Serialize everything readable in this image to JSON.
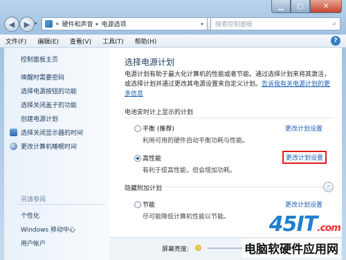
{
  "window": {
    "minimize_glyph": "▁",
    "maximize_glyph": "□",
    "close_glyph": "✕"
  },
  "nav": {
    "back_glyph": "◀",
    "forward_glyph": "▶",
    "dropdown_glyph": "▾",
    "breadcrumb_lead": "«",
    "breadcrumb": [
      "硬件和声音",
      "电源选项"
    ],
    "breadcrumb_sep": "▸",
    "refresh_glyph": "↻",
    "search_placeholder": "搜索控制面板",
    "search_glyph": "⌕"
  },
  "menu": {
    "items": [
      "文件(F)",
      "编辑(E)",
      "查看(V)",
      "工具(T)",
      "帮助(H)"
    ],
    "help_glyph": "?"
  },
  "sidebar": {
    "home": "控制面板主页",
    "items": [
      "唤醒时需要密码",
      "选择电源按钮的功能",
      "选择关闭盖子的功能",
      "创建电源计划",
      "选择关闭显示器的时间",
      "更改计算机睡眠时间"
    ],
    "see_also_heading": "另请参阅",
    "see_also": [
      "个性化",
      "Windows 移动中心",
      "用户帐户"
    ]
  },
  "main": {
    "title": "选择电源计划",
    "description": "电源计划有助于最大化计算机的性能或者节能。通过选择计划来将其激活，或选择计划并通过更改其电源设置来自定义计划。",
    "description_link": "告诉我有关电源计划的更多信息",
    "section_battery": "电池安时计上显示的计划",
    "plans": [
      {
        "name": "平衡 (推荐)",
        "desc": "利用可用的硬件自动平衡功耗与性能。",
        "link": "更改计划设置",
        "selected": false
      },
      {
        "name": "高性能",
        "desc": "有利于提高性能，但会增加功耗。",
        "link": "更改计划设置",
        "selected": true
      }
    ],
    "section_hidden": "隐藏附加计划",
    "collapse_glyph": "⌃",
    "hidden_plans": [
      {
        "name": "节能",
        "desc": "尽可能降低计算机性能以节能。",
        "link": "更改计划设置",
        "selected": false
      }
    ],
    "brightness_label": "屏幕亮度:"
  },
  "watermark": {
    "logo": "45IT",
    "logo_suffix": ".com",
    "subtitle": "电脑软硬件应用网"
  },
  "colors": {
    "highlight_box": "#e21a1a",
    "link": "#1a5fb4",
    "accent": "#3a7fc4"
  }
}
